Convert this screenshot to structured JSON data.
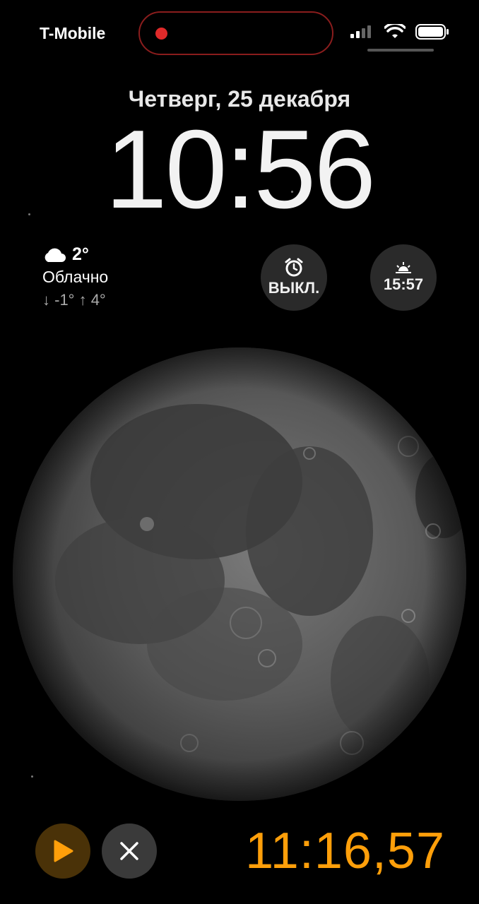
{
  "status_bar": {
    "carrier": "T-Mobile"
  },
  "lock_screen": {
    "date": "Четверг, 25 декабря",
    "time": "10:56"
  },
  "weather": {
    "temperature": "2°",
    "condition": "Облачно",
    "range": "↓ -1° ↑ 4°",
    "icon": "cloud-icon"
  },
  "widgets": {
    "alarm": {
      "label": "ВЫКЛ.",
      "icon": "alarm-clock-icon"
    },
    "sunset": {
      "label": "15:57",
      "icon": "sunset-icon"
    }
  },
  "timer": {
    "value": "11:16,57",
    "play_icon": "play-icon",
    "close_icon": "close-icon"
  },
  "colors": {
    "accent": "#ff9f0a",
    "recording": "#e02a2a"
  }
}
